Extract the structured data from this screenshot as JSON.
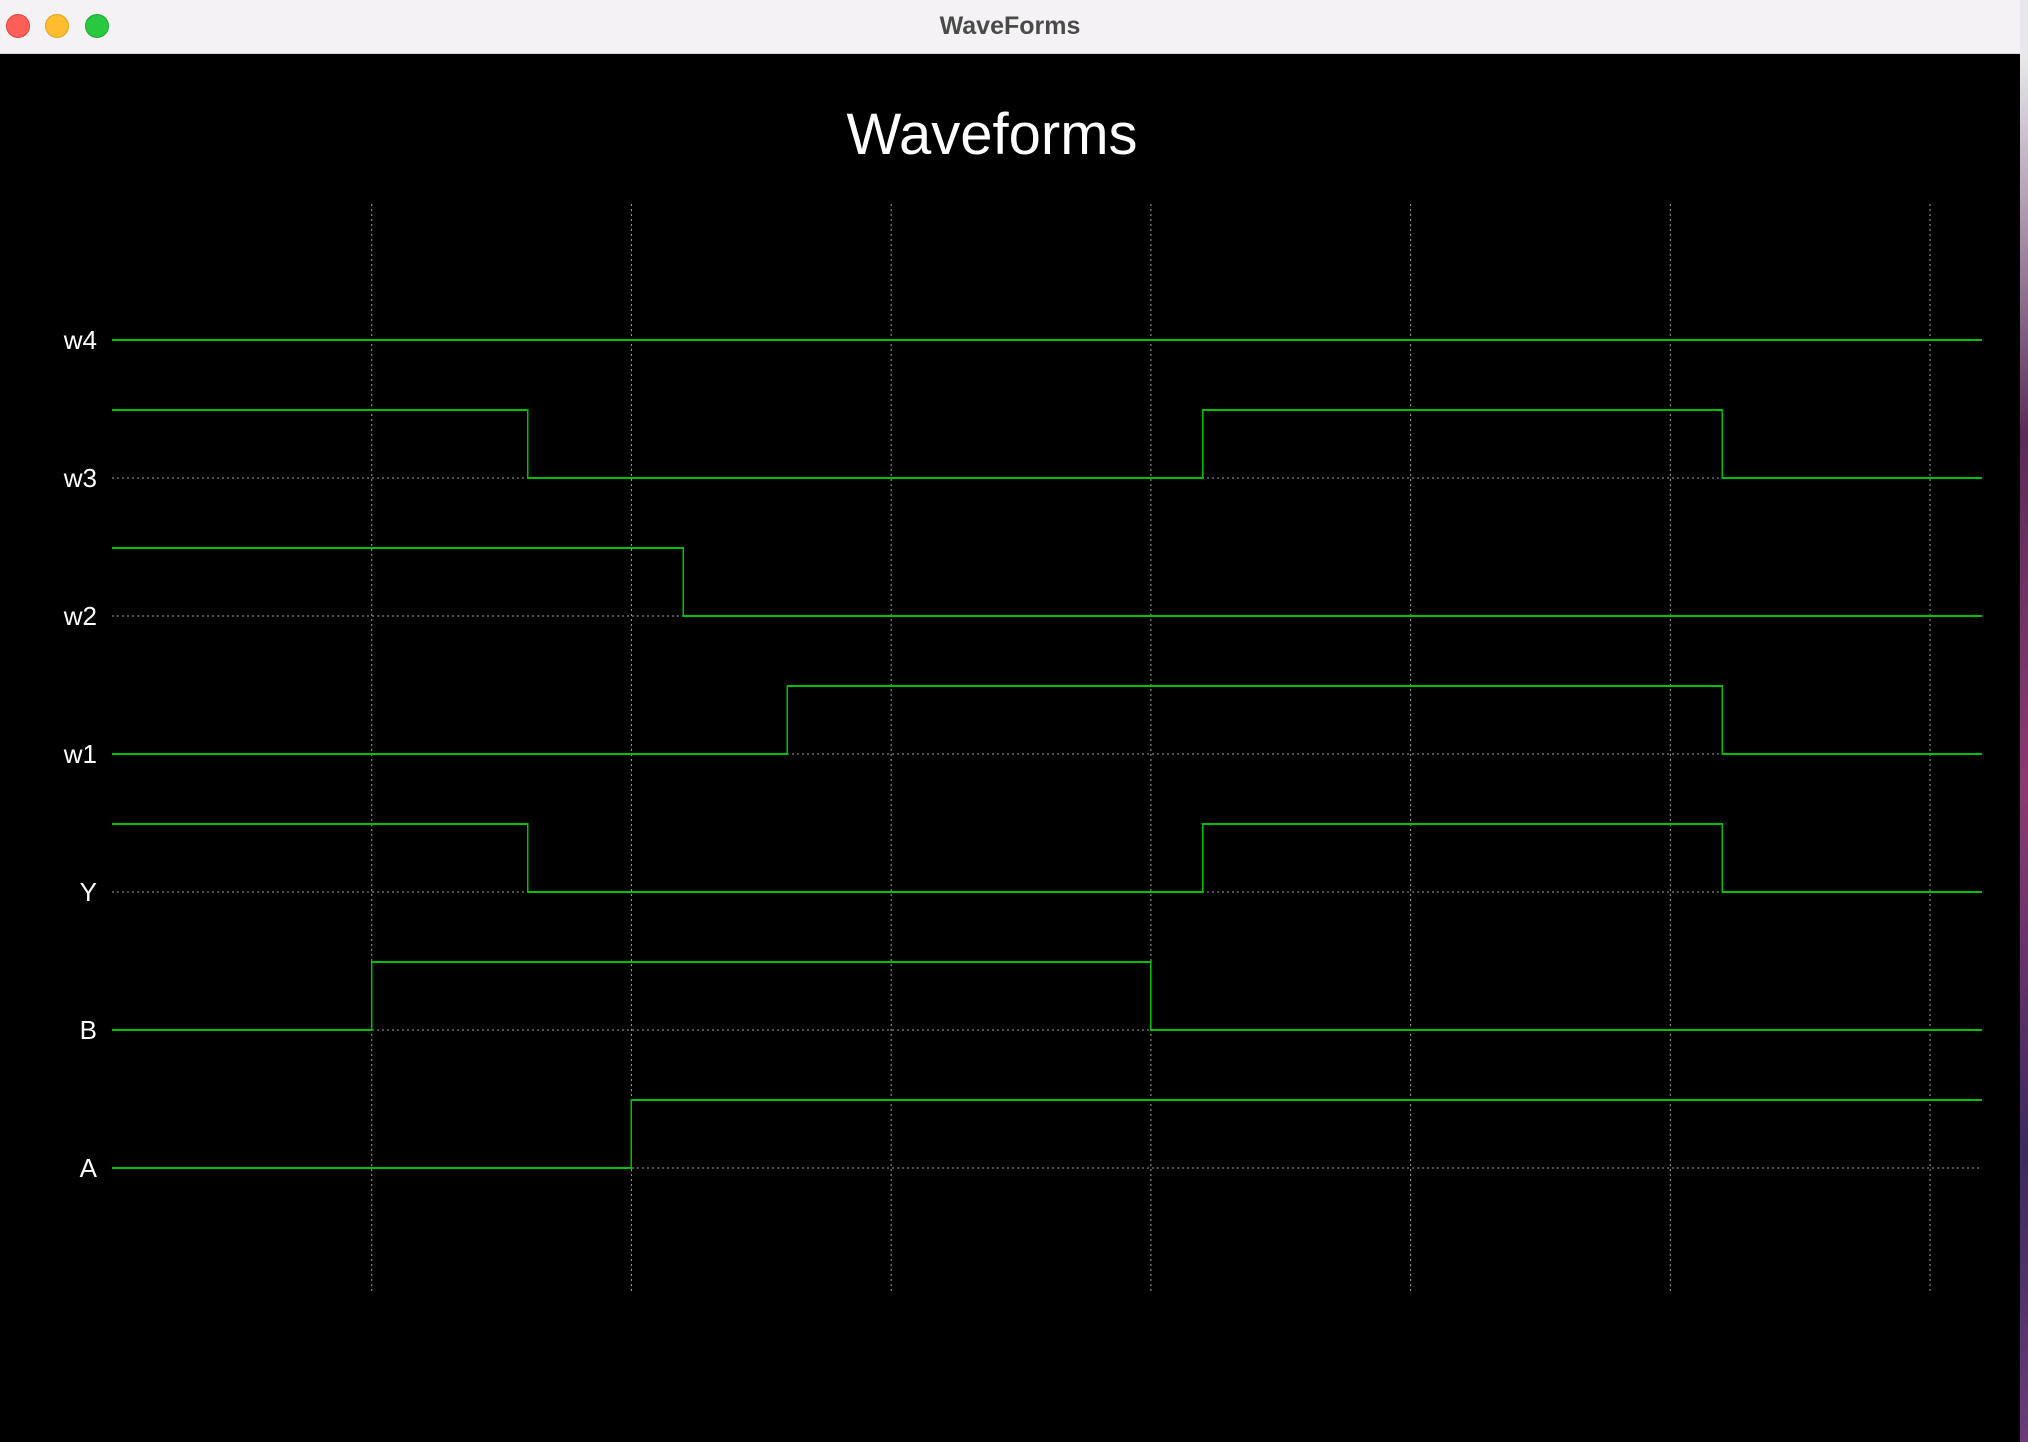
{
  "window": {
    "title": "WaveForms",
    "buttons": [
      {
        "name": "close",
        "color": "#ff5f57"
      },
      {
        "name": "minimize",
        "color": "#febc2e"
      },
      {
        "name": "zoom",
        "color": "#28c840"
      }
    ]
  },
  "colors": {
    "background": "#000000",
    "trace": "#00c000",
    "grid": "#a0a0a0",
    "text": "#ffffff"
  },
  "chart_data": {
    "type": "line",
    "title": "Waveforms",
    "xlabel": "",
    "ylabel": "",
    "xlim": [
      0,
      36
    ],
    "grid": true,
    "grid_x": [
      5,
      10,
      15,
      20,
      25,
      30,
      35
    ],
    "series": [
      {
        "name": "w4",
        "transitions": [
          [
            0,
            0
          ]
        ]
      },
      {
        "name": "w3",
        "transitions": [
          [
            0,
            1
          ],
          [
            8,
            0
          ],
          [
            21,
            1
          ],
          [
            31,
            0
          ]
        ]
      },
      {
        "name": "w2",
        "transitions": [
          [
            0,
            1
          ],
          [
            11,
            0
          ]
        ]
      },
      {
        "name": "w1",
        "transitions": [
          [
            0,
            0
          ],
          [
            13,
            1
          ],
          [
            31,
            0
          ]
        ]
      },
      {
        "name": "Y",
        "transitions": [
          [
            0,
            1
          ],
          [
            8,
            0
          ],
          [
            21,
            1
          ],
          [
            31,
            0
          ]
        ]
      },
      {
        "name": "B",
        "transitions": [
          [
            0,
            0
          ],
          [
            5,
            1
          ],
          [
            20,
            0
          ]
        ]
      },
      {
        "name": "A",
        "transitions": [
          [
            0,
            0
          ],
          [
            10,
            1
          ]
        ]
      }
    ]
  }
}
